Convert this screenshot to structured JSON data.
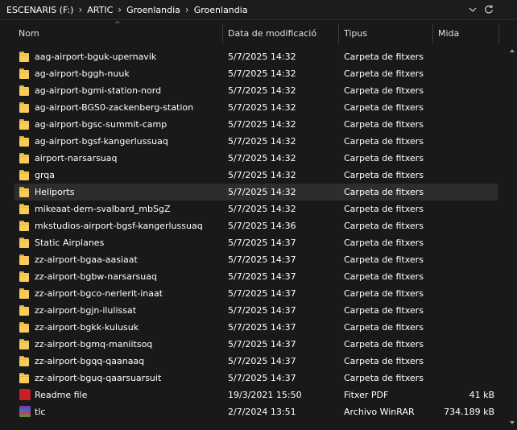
{
  "address": {
    "crumbs": [
      "ESCENARIS (F:)",
      "ARTIC",
      "Groenlandia",
      "Groenlandia"
    ],
    "separator": "›",
    "dropdown_icon": "chevron-down-icon",
    "refresh_icon": "refresh-icon"
  },
  "columns": {
    "name": "Nom",
    "date": "Data de modificació",
    "type": "Tipus",
    "size": "Mida",
    "sort_indicator": "^"
  },
  "files": [
    {
      "name": "aag-airport-bguk-upernavik",
      "date": "5/7/2025 14:32",
      "type": "Carpeta de fitxers",
      "size": "",
      "icon": "folder-icon"
    },
    {
      "name": "ag-airport-bggh-nuuk",
      "date": "5/7/2025 14:32",
      "type": "Carpeta de fitxers",
      "size": "",
      "icon": "folder-icon"
    },
    {
      "name": "ag-airport-bgmi-station-nord",
      "date": "5/7/2025 14:32",
      "type": "Carpeta de fitxers",
      "size": "",
      "icon": "folder-icon"
    },
    {
      "name": "ag-airport-BGS0-zackenberg-station",
      "date": "5/7/2025 14:32",
      "type": "Carpeta de fitxers",
      "size": "",
      "icon": "folder-icon"
    },
    {
      "name": "ag-airport-bgsc-summit-camp",
      "date": "5/7/2025 14:32",
      "type": "Carpeta de fitxers",
      "size": "",
      "icon": "folder-icon"
    },
    {
      "name": "ag-airport-bgsf-kangerlussuaq",
      "date": "5/7/2025 14:32",
      "type": "Carpeta de fitxers",
      "size": "",
      "icon": "folder-icon"
    },
    {
      "name": "airport-narsarsuaq",
      "date": "5/7/2025 14:32",
      "type": "Carpeta de fitxers",
      "size": "",
      "icon": "folder-icon"
    },
    {
      "name": "grqa",
      "date": "5/7/2025 14:32",
      "type": "Carpeta de fitxers",
      "size": "",
      "icon": "folder-icon"
    },
    {
      "name": "Heliports",
      "date": "5/7/2025 14:32",
      "type": "Carpeta de fitxers",
      "size": "",
      "icon": "folder-icon",
      "highlighted": true
    },
    {
      "name": "mikeaat-dem-svalbard_mbSgZ",
      "date": "5/7/2025 14:32",
      "type": "Carpeta de fitxers",
      "size": "",
      "icon": "folder-icon"
    },
    {
      "name": "mkstudios-airport-bgsf-kangerlussuaq",
      "date": "5/7/2025 14:36",
      "type": "Carpeta de fitxers",
      "size": "",
      "icon": "folder-icon"
    },
    {
      "name": "Static Airplanes",
      "date": "5/7/2025 14:37",
      "type": "Carpeta de fitxers",
      "size": "",
      "icon": "folder-icon"
    },
    {
      "name": "zz-airport-bgaa-aasiaat",
      "date": "5/7/2025 14:37",
      "type": "Carpeta de fitxers",
      "size": "",
      "icon": "folder-icon"
    },
    {
      "name": "zz-airport-bgbw-narsarsuaq",
      "date": "5/7/2025 14:37",
      "type": "Carpeta de fitxers",
      "size": "",
      "icon": "folder-icon"
    },
    {
      "name": "zz-airport-bgco-nerlerit-inaat",
      "date": "5/7/2025 14:37",
      "type": "Carpeta de fitxers",
      "size": "",
      "icon": "folder-icon"
    },
    {
      "name": "zz-airport-bgjn-ilulissat",
      "date": "5/7/2025 14:37",
      "type": "Carpeta de fitxers",
      "size": "",
      "icon": "folder-icon"
    },
    {
      "name": "zz-airport-bgkk-kulusuk",
      "date": "5/7/2025 14:37",
      "type": "Carpeta de fitxers",
      "size": "",
      "icon": "folder-icon"
    },
    {
      "name": "zz-airport-bgmq-maniitsoq",
      "date": "5/7/2025 14:37",
      "type": "Carpeta de fitxers",
      "size": "",
      "icon": "folder-icon"
    },
    {
      "name": "zz-airport-bgqq-qaanaaq",
      "date": "5/7/2025 14:37",
      "type": "Carpeta de fitxers",
      "size": "",
      "icon": "folder-icon"
    },
    {
      "name": "zz-airport-bguq-qaarsuarsuit",
      "date": "5/7/2025 14:37",
      "type": "Carpeta de fitxers",
      "size": "",
      "icon": "folder-icon"
    },
    {
      "name": "Readme file",
      "date": "19/3/2021 15:50",
      "type": "Fitxer PDF",
      "size": "41 kB",
      "icon": "pdf-file-icon"
    },
    {
      "name": "tlc",
      "date": "2/7/2024 13:51",
      "type": "Archivo WinRAR",
      "size": "734.189 kB",
      "icon": "winrar-archive-icon"
    }
  ],
  "colors": {
    "background": "#191919",
    "text": "#ffffff",
    "highlight_row": "#2d2d2d",
    "folder": "#f7cd57",
    "scrollbar_arrow": "#9a9a9a"
  }
}
